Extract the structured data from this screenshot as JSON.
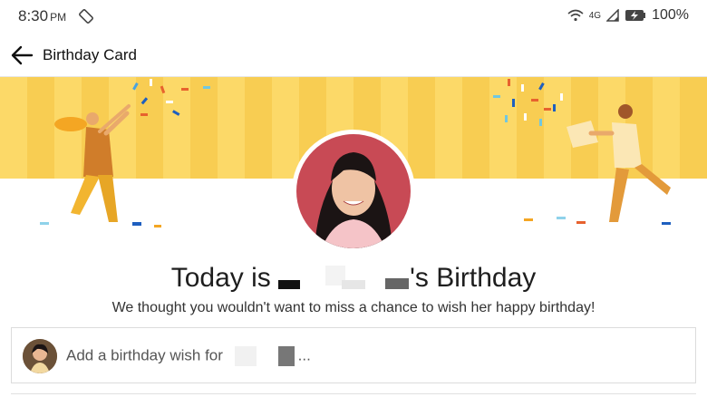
{
  "status_bar": {
    "time": "8:30",
    "ampm": "PM",
    "network": "4G",
    "battery": "100%"
  },
  "toolbar": {
    "title": "Birthday Card"
  },
  "card": {
    "headline_prefix": "Today is",
    "headline_suffix": "'s Birthday",
    "subline": "We thought you wouldn't want to miss a chance to wish her happy birthday!"
  },
  "wish": {
    "placeholder_prefix": "Add a birthday wish for",
    "placeholder_suffix": "..."
  },
  "colors": {
    "banner_light": "#fcd968",
    "banner_dark": "#f8cd52",
    "avatar_bg": "#c84a55"
  },
  "icons": [
    "screen-rotate-icon",
    "wifi-icon",
    "signal-icon",
    "battery-charging-icon",
    "back-arrow-icon"
  ]
}
